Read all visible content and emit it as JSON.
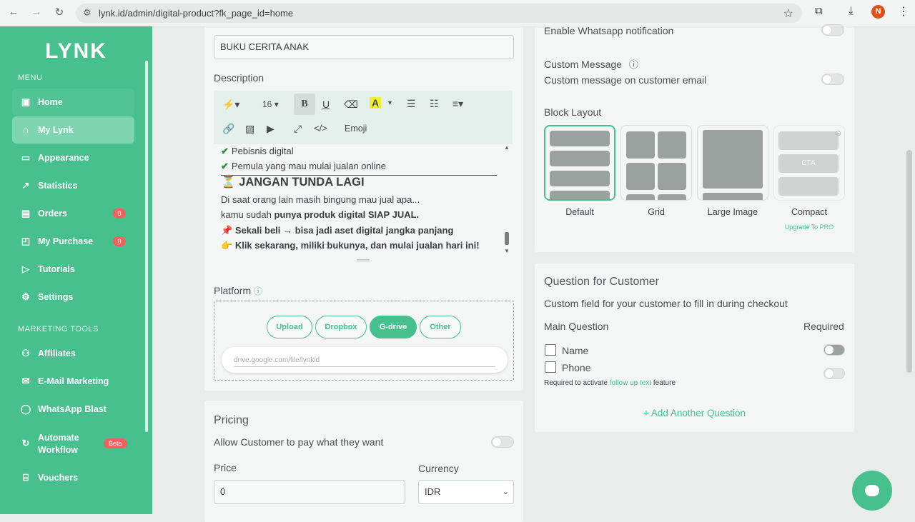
{
  "browser": {
    "url": "lynk.id/admin/digital-product?fk_page_id=home",
    "profile_initial": "N"
  },
  "sidebar": {
    "logo": "LYNK",
    "menu_label": "MENU",
    "items": [
      {
        "label": "Home",
        "icon": "home-icon"
      },
      {
        "label": "My Lynk",
        "icon": "lynk-icon"
      },
      {
        "label": "Appearance",
        "icon": "monitor-icon"
      },
      {
        "label": "Statistics",
        "icon": "trend-icon"
      },
      {
        "label": "Orders",
        "icon": "orders-icon",
        "badge": "0"
      },
      {
        "label": "My Purchase",
        "icon": "bag-icon",
        "badge": "0"
      },
      {
        "label": "Tutorials",
        "icon": "play-icon"
      },
      {
        "label": "Settings",
        "icon": "gear-icon"
      }
    ],
    "marketing_label": "MARKETING TOOLS",
    "marketing_items": [
      {
        "label": "Affiliates",
        "icon": "users-icon"
      },
      {
        "label": "E-Mail Marketing",
        "icon": "mail-icon"
      },
      {
        "label": "WhatsApp Blast",
        "icon": "whatsapp-icon"
      },
      {
        "label": "Automate\nWorkflow",
        "icon": "refresh-icon",
        "badge": "Beta"
      },
      {
        "label": "Vouchers",
        "icon": "gift-icon"
      }
    ]
  },
  "product": {
    "title_value": "BUKU CERITA ANAK",
    "description_label": "Description",
    "toolbar": {
      "font_size": "16",
      "emoji": "Emoji"
    },
    "content_lines": [
      {
        "check": "✔",
        "text": "Pebisnis digital"
      },
      {
        "check": "✔",
        "text": "Pemula yang mau mulai jualan online"
      },
      {
        "emoji": "⏳",
        "text": "JANGAN TUNDA LAGI"
      },
      {
        "text": "Di saat orang lain masih bingung mau jual apa..."
      },
      {
        "text_plain": "kamu sudah ",
        "text_bold": "punya produk digital SIAP JUAL."
      },
      {
        "emoji": "📌",
        "text": "Sekali beli → bisa jadi aset digital jangka panjang"
      },
      {
        "emoji": "👉",
        "text": "Klik sekarang, miliki bukunya, dan mulai jualan hari ini!"
      }
    ],
    "platform_label": "Platform",
    "platform_options": [
      "Upload",
      "Dropbox",
      "G-drive",
      "Other"
    ],
    "platform_selected": "G-drive",
    "link_placeholder": "drive.google.com/file/lynkid"
  },
  "pricing": {
    "title": "Pricing",
    "pay_what_want": "Allow Customer to pay what they want",
    "price_label": "Price",
    "price_value": "0",
    "currency_label": "Currency",
    "currency_value": "IDR"
  },
  "settings": {
    "whatsapp_notif": "Enable Whatsapp notification",
    "custom_message_title": "Custom Message",
    "custom_message_desc": "Custom message on customer email",
    "block_layout": "Block Layout",
    "layouts": [
      "Default",
      "Grid",
      "Large Image",
      "Compact"
    ],
    "cta_label": "CTA",
    "upgrade": "Upgrade To PRO"
  },
  "questions": {
    "title": "Question for Customer",
    "desc": "Custom field for your customer to fill in during checkout",
    "main_question": "Main Question",
    "required": "Required",
    "items": [
      "Name",
      "Phone"
    ],
    "note_pre": "Required to activate ",
    "note_link": "follow up text",
    "note_post": " feature",
    "add_button": "+ Add Another Question"
  },
  "colors": {
    "brand": "#47c08e",
    "badge": "#f0625d"
  }
}
